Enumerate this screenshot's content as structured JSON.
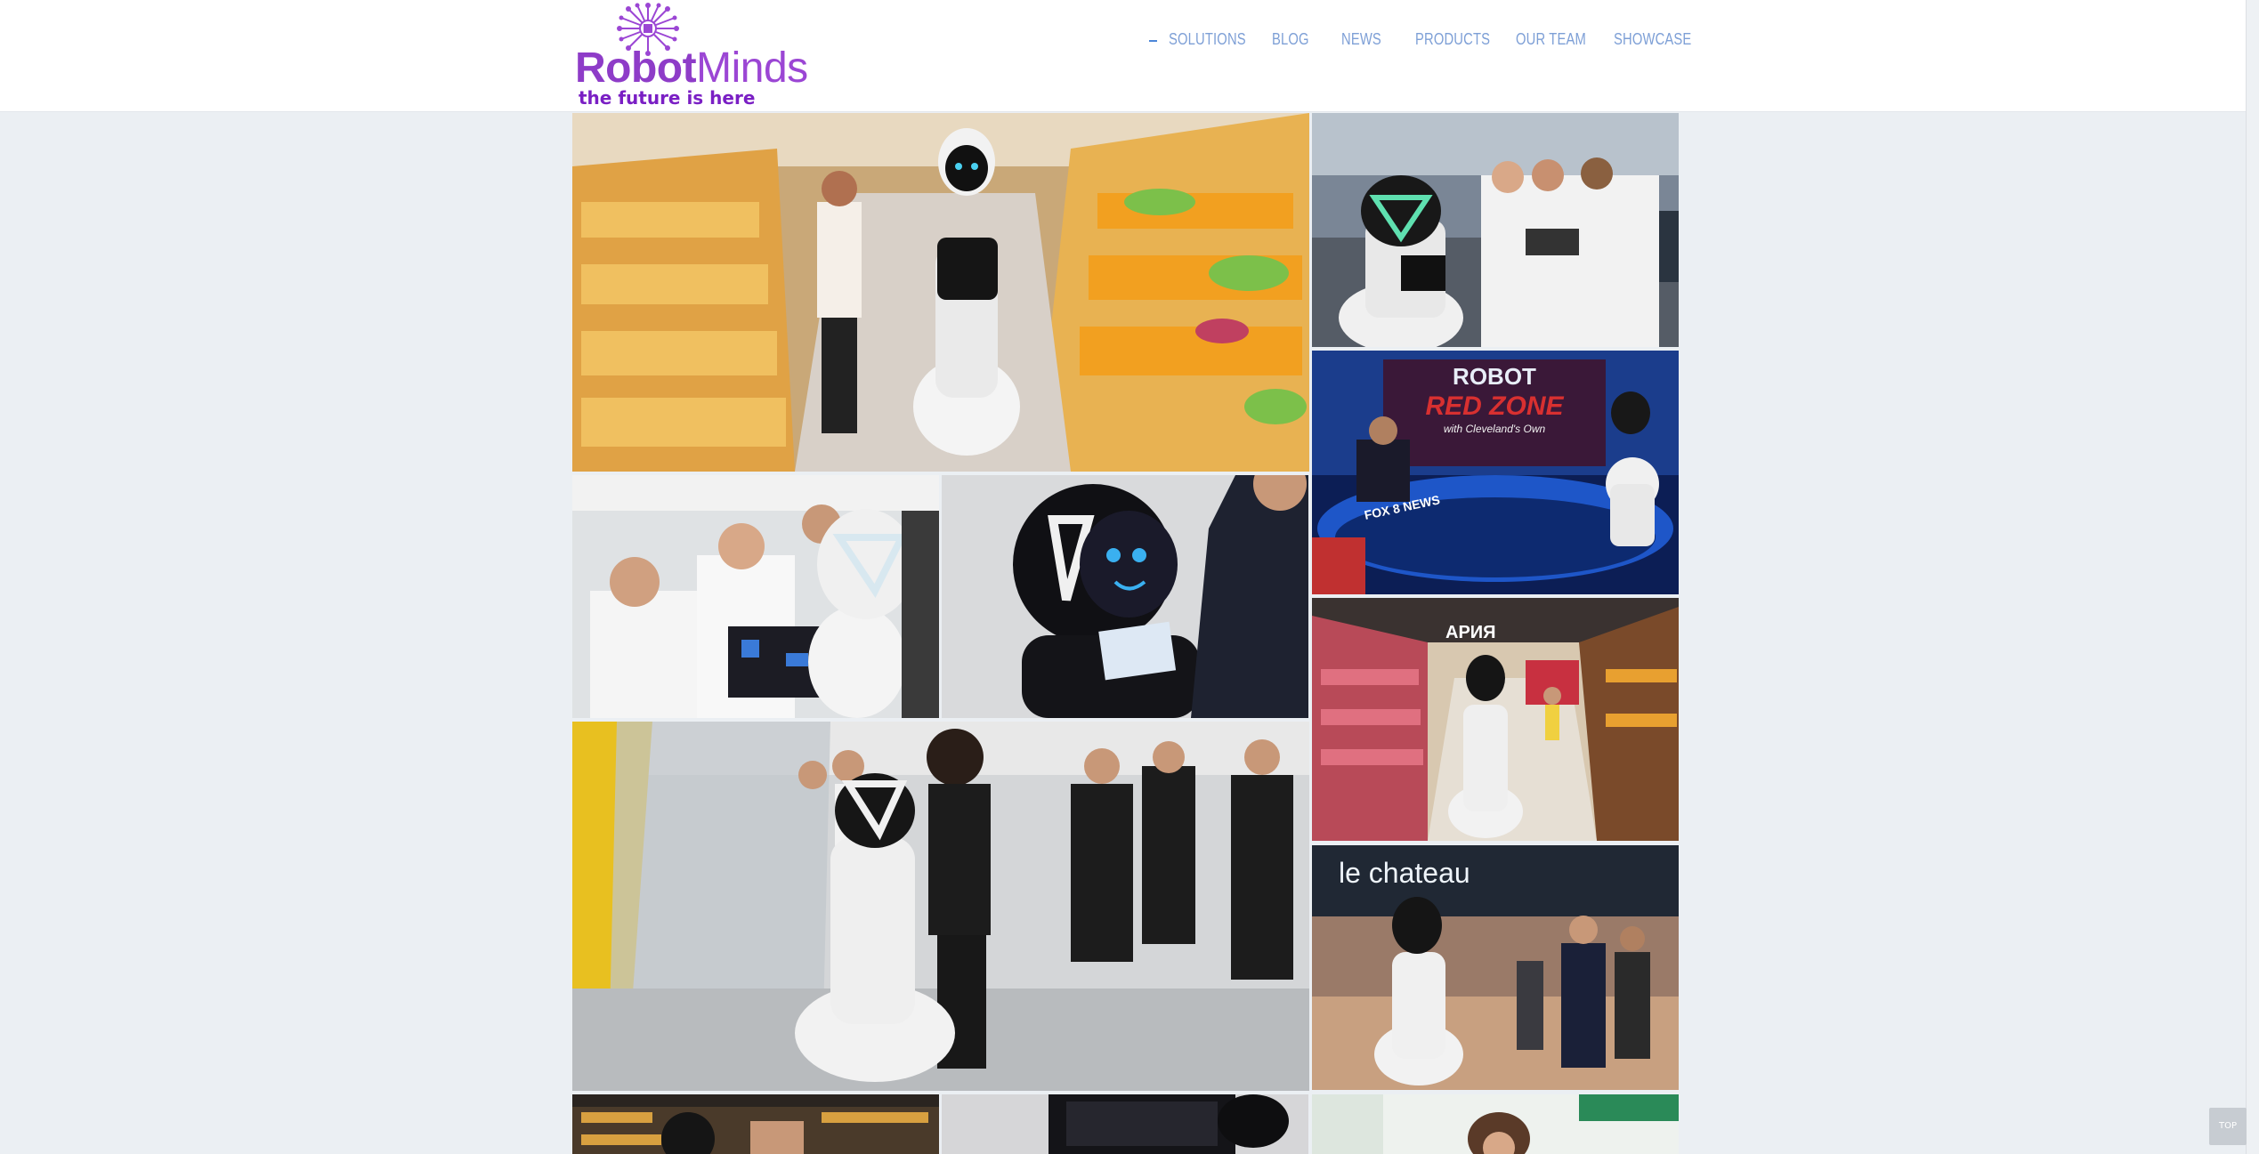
{
  "brand": {
    "name_part1": "Robot",
    "name_part2": "Minds",
    "tagline": "the future is here",
    "colors": {
      "primary": "#8e3cc8",
      "tagline": "#7a1fc4",
      "nav": "#7d9fd6"
    }
  },
  "nav": {
    "items": [
      {
        "label": "SOLUTIONS"
      },
      {
        "label": "BLOG"
      },
      {
        "label": "NEWS"
      },
      {
        "label": "PRODUCTS"
      },
      {
        "label": "OUR TEAM"
      },
      {
        "label": "SHOWCASE"
      }
    ]
  },
  "gallery": {
    "tiles": [
      {
        "name": "photo-supermarket-bakery",
        "tv": {
          "l1": "",
          "l2": "",
          "l3": "",
          "l4": ""
        }
      },
      {
        "name": "photo-engineers-laptop",
        "tv": {
          "l1": "",
          "l2": "",
          "l3": "",
          "l4": ""
        }
      },
      {
        "name": "photo-tv-studio",
        "tv": {
          "l1": "ROBOT",
          "l2": "RED ZONE",
          "l3": "with Cleveland's Own",
          "l4": "FOX 8 NEWS"
        }
      },
      {
        "name": "photo-assembly-team",
        "tv": {
          "l1": "",
          "l2": "",
          "l3": "",
          "l4": ""
        }
      },
      {
        "name": "photo-robot-tablet",
        "tv": {
          "l1": "",
          "l2": "",
          "l3": "",
          "l4": ""
        }
      },
      {
        "name": "photo-grocery-aisle",
        "tv": {
          "l1": "АРИЯ",
          "l2": "",
          "l3": "",
          "l4": ""
        }
      },
      {
        "name": "photo-office-crowd",
        "tv": {
          "l1": "",
          "l2": "",
          "l3": "",
          "l4": ""
        }
      },
      {
        "name": "photo-le-chateau",
        "tv": {
          "l1": "le chateau",
          "l2": "",
          "l3": "",
          "l4": ""
        }
      },
      {
        "name": "photo-store-shelves",
        "tv": {
          "l1": "",
          "l2": "",
          "l3": "",
          "l4": ""
        }
      },
      {
        "name": "photo-dark-screen",
        "tv": {
          "l1": "",
          "l2": "",
          "l3": "",
          "l4": ""
        }
      },
      {
        "name": "photo-office-woman",
        "tv": {
          "l1": "",
          "l2": "",
          "l3": "",
          "l4": ""
        }
      }
    ]
  },
  "scroll_top": {
    "label": "TOP"
  }
}
